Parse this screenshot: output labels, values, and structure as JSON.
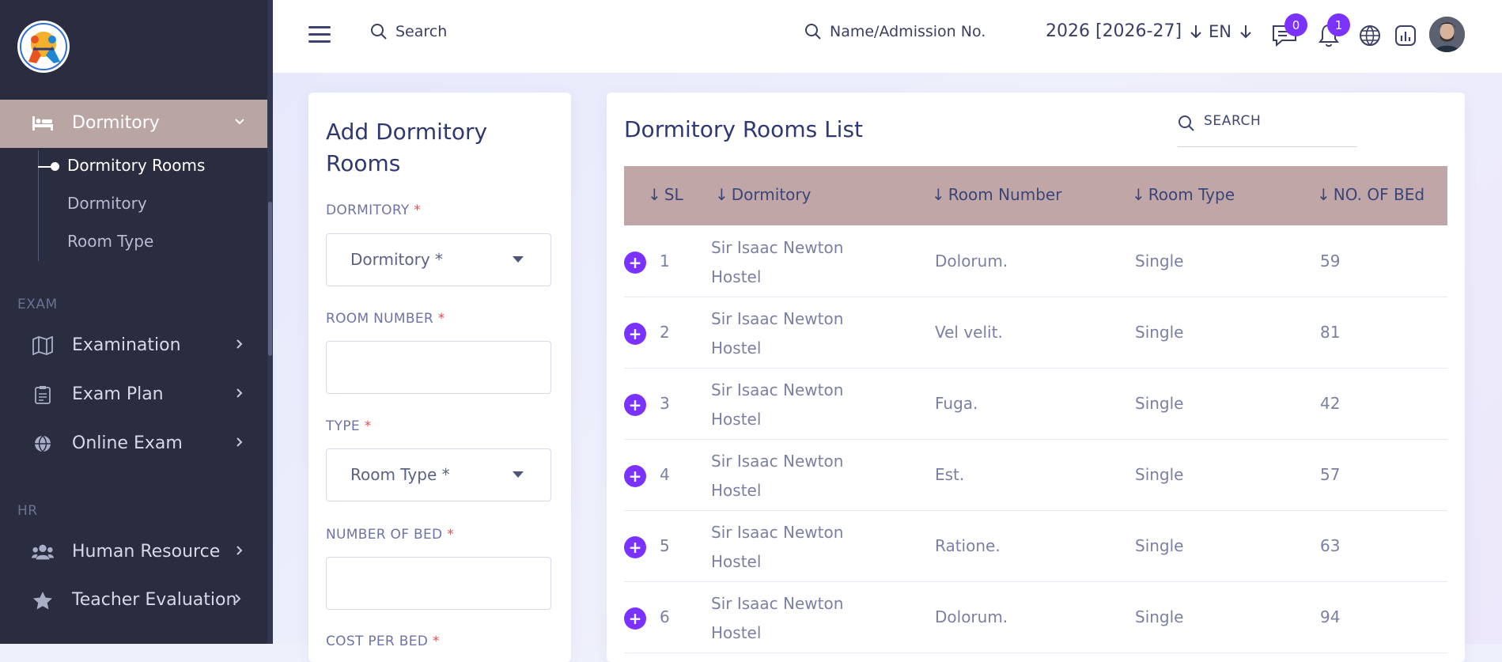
{
  "sidebar": {
    "active_menu": {
      "label": "Dormitory",
      "icon": "bed-icon"
    },
    "submenu": [
      {
        "label": "Dormitory Rooms",
        "active": true
      },
      {
        "label": "Dormitory",
        "active": false
      },
      {
        "label": "Room Type",
        "active": false
      }
    ],
    "sections": [
      {
        "heading": "EXAM",
        "items": [
          {
            "label": "Examination",
            "icon": "map-icon"
          },
          {
            "label": "Exam Plan",
            "icon": "clipboard-icon"
          },
          {
            "label": "Online Exam",
            "icon": "globe-icon"
          }
        ]
      },
      {
        "heading": "HR",
        "items": [
          {
            "label": "Human Resource",
            "icon": "users-icon"
          },
          {
            "label": "Teacher Evaluation",
            "icon": "star-icon"
          }
        ]
      }
    ]
  },
  "header": {
    "search_label": "Search",
    "admission_search_label": "Name/Admission No.",
    "session": "2026 [2026-27]",
    "language": "EN",
    "chat_count": "0",
    "notification_count": "1"
  },
  "form": {
    "title": "Add Dormitory Rooms",
    "fields": {
      "dormitory": {
        "label": "DORMITORY",
        "required": "*",
        "value": "Dormitory *"
      },
      "room_number": {
        "label": "ROOM NUMBER",
        "required": "*",
        "value": ""
      },
      "type": {
        "label": "TYPE",
        "required": "*",
        "value": "Room Type *"
      },
      "number_of_bed": {
        "label": "NUMBER OF BED",
        "required": "*",
        "value": ""
      },
      "cost_per_bed": {
        "label": "COST PER BED",
        "required": "*"
      }
    }
  },
  "list": {
    "title": "Dormitory Rooms List",
    "search_label": "SEARCH",
    "columns": [
      "SL",
      "Dormitory",
      "Room Number",
      "Room Type",
      "NO. OF BEd"
    ],
    "rows": [
      {
        "sl": "1",
        "dormitory": "Sir Isaac Newton Hostel",
        "room_number": "Dolorum.",
        "room_type": "Single",
        "beds": "59"
      },
      {
        "sl": "2",
        "dormitory": "Sir Isaac Newton Hostel",
        "room_number": "Vel velit.",
        "room_type": "Single",
        "beds": "81"
      },
      {
        "sl": "3",
        "dormitory": "Sir Isaac Newton Hostel",
        "room_number": "Fuga.",
        "room_type": "Single",
        "beds": "42"
      },
      {
        "sl": "4",
        "dormitory": "Sir Isaac Newton Hostel",
        "room_number": "Est.",
        "room_type": "Single",
        "beds": "57"
      },
      {
        "sl": "5",
        "dormitory": "Sir Isaac Newton Hostel",
        "room_number": "Ratione.",
        "room_type": "Single",
        "beds": "63"
      },
      {
        "sl": "6",
        "dormitory": "Sir Isaac Newton Hostel",
        "room_number": "Dolorum.",
        "room_type": "Single",
        "beds": "94"
      }
    ]
  },
  "colors": {
    "sidebar_bg": "#2a2c3f",
    "active_menu_bg": "#b9a5a3",
    "table_head_bg": "#c0a6a6",
    "accent": "#7c32ff",
    "required": "#e54d4d"
  }
}
